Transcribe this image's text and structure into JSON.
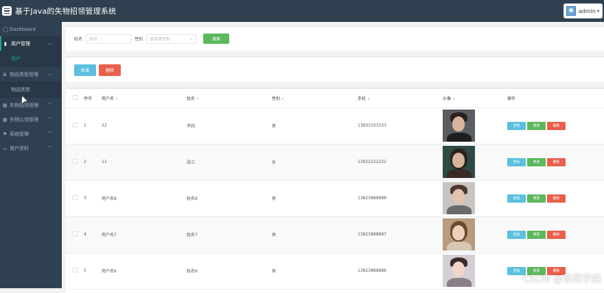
{
  "app": {
    "title": "基于Java的失物招领管理系统"
  },
  "user": {
    "name": "admin"
  },
  "sidebar": {
    "items": [
      {
        "label": "Dashboard",
        "icon": "dashboard-icon"
      },
      {
        "label": "用户管理",
        "icon": "bar-chart-icon",
        "expanded": true
      },
      {
        "label": "用户",
        "sub": true,
        "current": true
      },
      {
        "label": "物品类型管理",
        "icon": "list-icon",
        "expanded": true
      },
      {
        "label": "物品类型",
        "sub": true
      },
      {
        "label": "失物招领管理",
        "icon": "grid-icon"
      },
      {
        "label": "失物认领管理",
        "icon": "grid-icon"
      },
      {
        "label": "系统管理",
        "icon": "flag-icon"
      },
      {
        "label": "用户资料",
        "icon": "card-icon"
      }
    ]
  },
  "search": {
    "name_label": "姓名",
    "name_placeholder": "姓名",
    "gender_label": "性别",
    "gender_placeholder": "请选择性别",
    "search_button": "搜索"
  },
  "actions": {
    "add_button": "新增",
    "delete_button": "删除"
  },
  "table": {
    "columns": [
      "序号",
      "用户名",
      "姓名",
      "性别",
      "手机",
      "头像",
      "操作"
    ],
    "op_labels": {
      "view": "查看",
      "edit": "修改",
      "delete": "删除"
    },
    "rows": [
      {
        "index": "1",
        "username": "22",
        "name": "李四",
        "gender": "男",
        "phone": "13933333333"
      },
      {
        "index": "2",
        "username": "11",
        "name": "张三",
        "gender": "女",
        "phone": "13922222222"
      },
      {
        "index": "3",
        "username": "用户名8",
        "name": "姓名8",
        "gender": "男",
        "phone": "13823888888"
      },
      {
        "index": "4",
        "username": "用户名7",
        "name": "姓名7",
        "gender": "男",
        "phone": "13823888887"
      },
      {
        "index": "5",
        "username": "用户名6",
        "name": "姓名6",
        "gender": "男",
        "phone": "13823888886"
      }
    ]
  },
  "watermark": "CSDN @茄茹学姐"
}
